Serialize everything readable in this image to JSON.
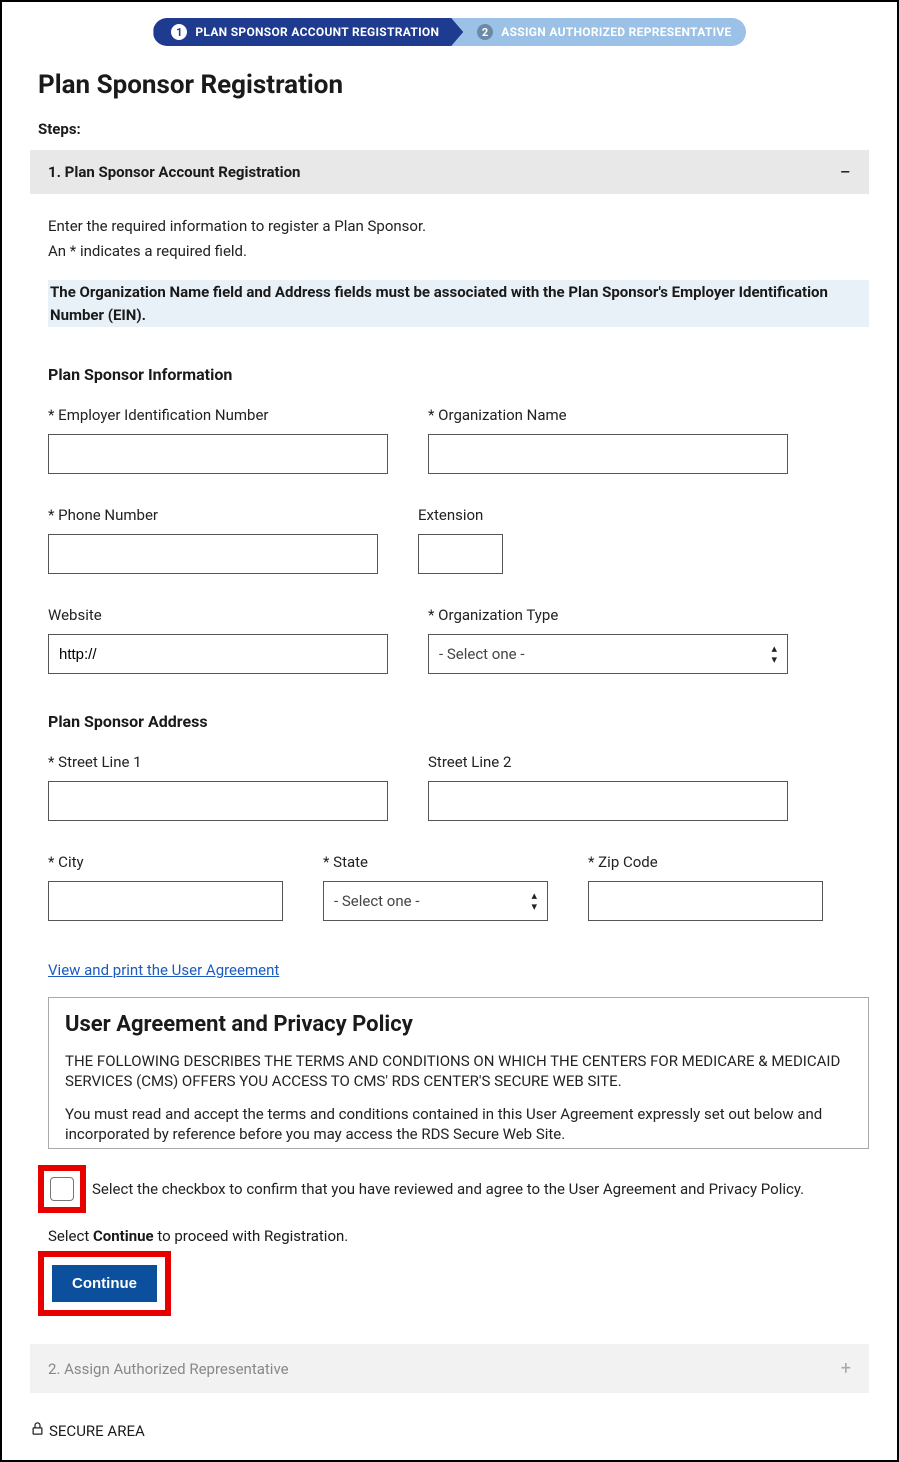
{
  "stepper": {
    "step1": {
      "num": "1",
      "label": "PLAN SPONSOR ACCOUNT REGISTRATION"
    },
    "step2": {
      "num": "2",
      "label": "ASSIGN AUTHORIZED REPRESENTATIVE"
    }
  },
  "page_title": "Plan Sponsor Registration",
  "steps_label": "Steps:",
  "accordion1": {
    "title": "1. Plan Sponsor Account Registration",
    "intro_line1": "Enter the required information to register a Plan Sponsor.",
    "intro_line2": "An * indicates a required field.",
    "highlight": "The Organization Name field and Address fields must be associated with the Plan Sponsor's Employer Identification Number (EIN)."
  },
  "section_info_title": "Plan Sponsor Information",
  "fields": {
    "ein_label": "* Employer Identification Number",
    "orgname_label": "* Organization Name",
    "phone_label": "* Phone Number",
    "ext_label": "Extension",
    "website_label": "Website",
    "website_value": "http://",
    "orgtype_label": "* Organization Type",
    "orgtype_value": "- Select one -"
  },
  "section_addr_title": "Plan Sponsor Address",
  "addr": {
    "street1_label": "* Street Line 1",
    "street2_label": "Street Line 2",
    "city_label": "* City",
    "state_label": "* State",
    "state_value": "- Select one -",
    "zip_label": "* Zip Code"
  },
  "ua_link": "View and print the User Agreement",
  "agreement": {
    "heading": "User Agreement and Privacy Policy",
    "p1": "THE FOLLOWING DESCRIBES THE TERMS AND CONDITIONS ON WHICH THE CENTERS FOR MEDICARE & MEDICAID SERVICES (CMS) OFFERS YOU ACCESS TO CMS' RDS CENTER'S SECURE WEB SITE.",
    "p2": "You must read and accept the terms and conditions contained in this User Agreement expressly set out below and incorporated by reference before you may access the RDS Secure Web Site."
  },
  "confirm_text": "Select the checkbox to confirm that you have reviewed and agree to the User Agreement and Privacy Policy.",
  "proceed_prefix": "Select ",
  "proceed_bold": "Continue",
  "proceed_suffix": " to proceed with Registration.",
  "continue_label": "Continue",
  "accordion2_title": "2. Assign Authorized Representative",
  "secure_area": "SECURE AREA"
}
